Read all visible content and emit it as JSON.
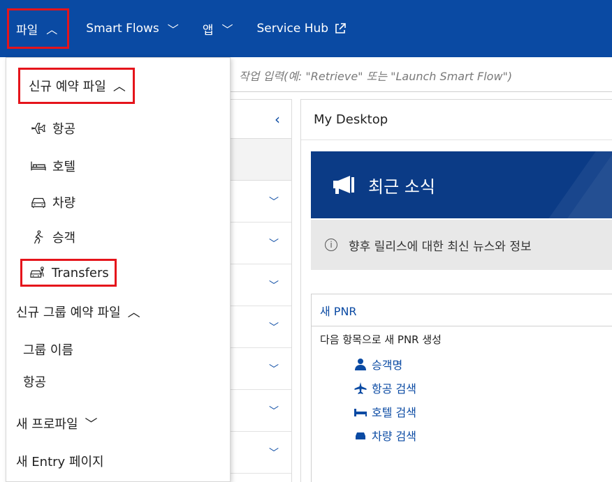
{
  "topnav": {
    "file_label": "파일",
    "smartflows_label": "Smart Flows",
    "apps_label": "앱",
    "servicehub_label": "Service Hub"
  },
  "command": {
    "placeholder": "작업 입력(예: \"Retrieve\" 또는 \"Launch Smart Flow\")"
  },
  "dropdown": {
    "new_booking_label": "신규 예약 파일",
    "booking_items": [
      {
        "label": "항공",
        "icon": "airplane-icon"
      },
      {
        "label": "호텔",
        "icon": "bed-icon"
      },
      {
        "label": "차량",
        "icon": "car-icon"
      },
      {
        "label": "승객",
        "icon": "walking-person-icon"
      },
      {
        "label": "Transfers",
        "icon": "transfer-car-icon"
      }
    ],
    "group_booking_label": "신규 그룹 예약 파일",
    "group_items": [
      {
        "label": "그룹 이름"
      },
      {
        "label": "항공"
      }
    ],
    "new_profile_label": "새 프로파일",
    "new_entry_label": "새 Entry 페이지"
  },
  "desktop": {
    "title": "My Desktop",
    "news_title": "최근 소식",
    "info_text": "향후 릴리스에 대한 최신 뉴스와 정보",
    "pnr_title": "새 PNR",
    "pnr_subtitle": "다음 항목으로 새 PNR 생성",
    "pnr_links": [
      "승객명",
      "항공 검색",
      "호텔 검색",
      "차량 검색"
    ]
  },
  "colors": {
    "brand_blue": "#0a4aa3",
    "highlight_red": "#e5141b",
    "banner_navy": "#0b3b86"
  }
}
